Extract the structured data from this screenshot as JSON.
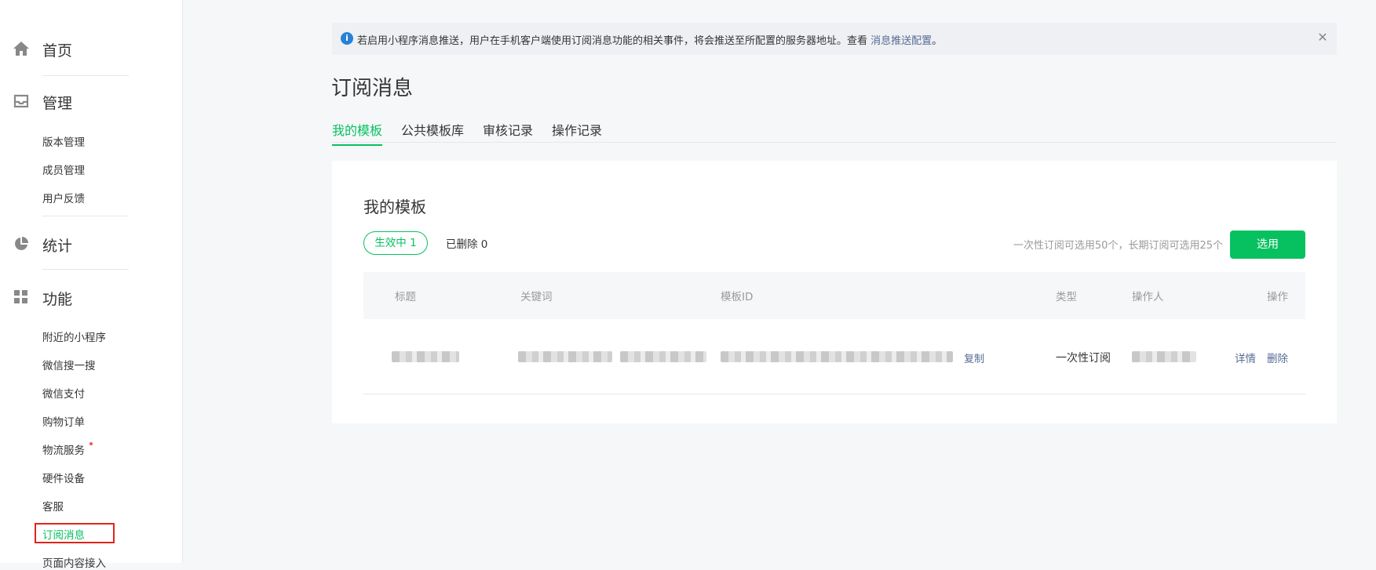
{
  "sidebar": {
    "sections": [
      {
        "label": "首页",
        "icon": "home-icon"
      },
      {
        "label": "管理",
        "icon": "inbox-icon"
      },
      {
        "label": "统计",
        "icon": "pie-chart-icon"
      },
      {
        "label": "功能",
        "icon": "grid-icon"
      }
    ],
    "manage_items": [
      "版本管理",
      "成员管理",
      "用户反馈"
    ],
    "feature_items": [
      "附近的小程序",
      "微信搜一搜",
      "微信支付",
      "购物订单",
      "物流服务",
      "硬件设备",
      "客服",
      "订阅消息",
      "页面内容接入"
    ],
    "active_item": "订阅消息"
  },
  "notice": {
    "text": "若启用小程序消息推送，用户在手机客户端使用订阅消息功能的相关事件，将会推送至所配置的服务器地址。查看 ",
    "link": "消息推送配置",
    "suffix": "。"
  },
  "page_title": "订阅消息",
  "tabs": [
    "我的模板",
    "公共模板库",
    "审核记录",
    "操作记录"
  ],
  "card": {
    "title": "我的模板",
    "active_filter": "生效中  1",
    "deleted_filter": "已删除  0",
    "quota": "一次性订阅可选用50个，长期订阅可选用25个",
    "select_button": "选用"
  },
  "table": {
    "headers": [
      "标题",
      "关键词",
      "模板ID",
      "类型",
      "操作人",
      "操作"
    ],
    "row": {
      "copy": "复制",
      "type": "一次性订阅",
      "detail": "详情",
      "delete": "删除"
    }
  },
  "colors": {
    "accent": "#07c160",
    "link": "#576b95",
    "highlight": "#e2231a"
  }
}
